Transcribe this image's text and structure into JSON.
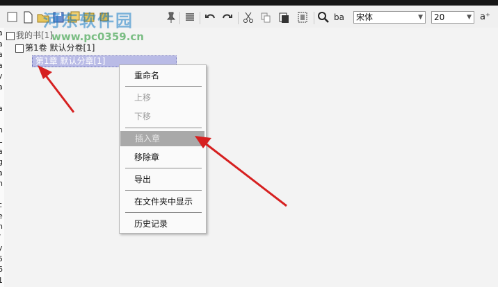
{
  "toolbar": {
    "font_name": "宋体",
    "font_size": "20",
    "grow_font_label": "a⁺",
    "find_replace_label": "ba"
  },
  "watermark": {
    "brand": "河东软件园",
    "url": "www.pc0359.cn"
  },
  "tree": {
    "root_label": "我的书[1]",
    "volume_label": "第1卷 默认分卷[1]",
    "chapter_label": "第1章 默认分章[1]"
  },
  "left_strip_chars": [
    "a",
    "a",
    "a",
    "a",
    "y",
    "a",
    "i",
    "a",
    "l",
    "n",
    "L",
    "a",
    "g",
    "a",
    "n",
    "i",
    "c",
    "e",
    "n",
    "/",
    "y",
    "5",
    "6",
    "1"
  ],
  "context_menu": {
    "rename": "重命名",
    "move_up": "上移",
    "move_down": "下移",
    "insert_chapter": "插入章",
    "remove_chapter": "移除章",
    "export": "导出",
    "show_in_folder": "在文件夹中显示",
    "history": "历史记录"
  },
  "colors": {
    "selection": "#b9bbe6",
    "arrow": "#d62020",
    "menu_hover": "#a9a9a9"
  }
}
